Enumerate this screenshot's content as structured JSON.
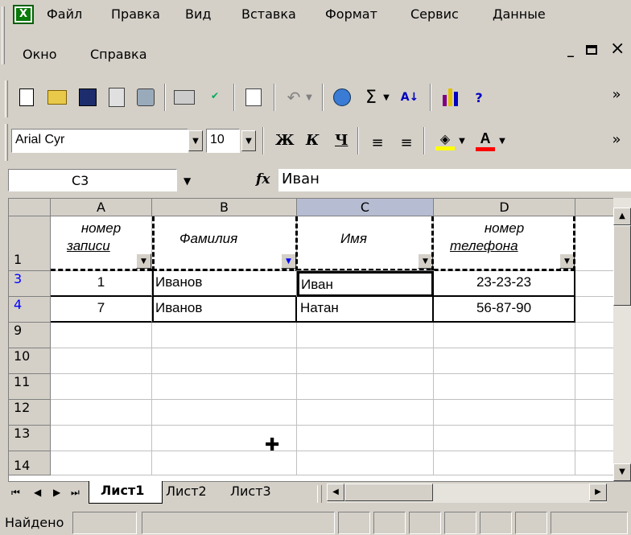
{
  "menu": {
    "items": [
      {
        "label": "Файл"
      },
      {
        "label": "Правка"
      },
      {
        "label": "Вид"
      },
      {
        "label": "Вставка"
      },
      {
        "label": "Формат"
      },
      {
        "label": "Сервис"
      },
      {
        "label": "Данные"
      },
      {
        "label": "Окно"
      },
      {
        "label": "Справка"
      }
    ]
  },
  "window_controls": {
    "minimize": "_",
    "restore": "▫",
    "close": "×"
  },
  "toolbar": {
    "icons": [
      "new-icon",
      "open-icon",
      "save-icon",
      "permission-icon",
      "print-preview-icon",
      "print-icon",
      "spelling-icon",
      "paste-icon",
      "undo-icon",
      "hyperlink-icon",
      "autosum-icon",
      "sort-ascending-icon",
      "chart-wizard-icon",
      "help-icon"
    ],
    "overflow": "»"
  },
  "format_toolbar": {
    "font_name": "Arial Cyr",
    "font_size": "10",
    "bold": "Ж",
    "italic": "К",
    "underline": "Ч",
    "overflow": "»"
  },
  "formula_bar": {
    "name_box": "C3",
    "fx": "fx",
    "value": "Иван"
  },
  "grid": {
    "columns": [
      "A",
      "B",
      "C",
      "D"
    ],
    "header_row": {
      "row_num": "1",
      "cells": [
        "номер записи",
        "Фамилия",
        "Имя",
        "номер телефона"
      ],
      "a_line1": "номер",
      "a_line2": "записи",
      "d_line1": "номер",
      "d_line2": "телефона"
    },
    "rows": [
      {
        "row_num": "3",
        "cells": [
          "1",
          "Иванов",
          "Иван",
          "23-23-23"
        ]
      },
      {
        "row_num": "4",
        "cells": [
          "7",
          "Иванов",
          "Натан",
          "56-87-90"
        ]
      },
      {
        "row_num": "9",
        "cells": [
          "",
          "",
          "",
          ""
        ]
      },
      {
        "row_num": "10",
        "cells": [
          "",
          "",
          "",
          ""
        ]
      },
      {
        "row_num": "11",
        "cells": [
          "",
          "",
          "",
          ""
        ]
      },
      {
        "row_num": "12",
        "cells": [
          "",
          "",
          "",
          ""
        ]
      },
      {
        "row_num": "13",
        "cells": [
          "",
          "",
          "",
          ""
        ]
      },
      {
        "row_num": "14",
        "cells": [
          "",
          "",
          "",
          ""
        ]
      }
    ]
  },
  "sheet_tabs": [
    "Лист1",
    "Лист2",
    "Лист3"
  ],
  "status_bar": {
    "text": "Найдено"
  },
  "colors": {
    "face": "#d4d0c8",
    "selected_header": "#b6bdd2",
    "filtered_rownum": "#0000ff"
  }
}
